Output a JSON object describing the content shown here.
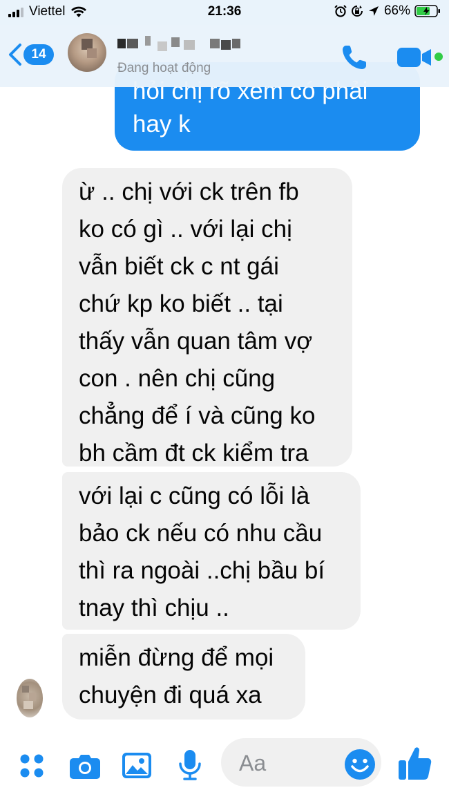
{
  "status_bar": {
    "carrier": "Viettel",
    "time": "21:36",
    "battery": "66%"
  },
  "header": {
    "unread_count": "14",
    "contact_status": "Đang hoạt động"
  },
  "messages": {
    "outgoing_partial": [
      "hỏi chị rõ xem có phải",
      "hay k"
    ],
    "incoming": [
      [
        "ừ .. chị với ck trên fb",
        "ko có gì  .. với lại chị",
        "vẫn biết ck c nt gái",
        "chứ kp ko biết .. tại",
        "thấy vẫn quan tâm vợ",
        "con . nên chị cũng",
        "chẳng để í và cũng ko",
        "bh cầm đt ck kiểm tra"
      ],
      [
        "với lại c cũng có lỗi là",
        "bảo ck nếu có nhu cầu",
        "thì ra ngoài ..chị bầu bí",
        "tnay thì chịu .."
      ],
      [
        "miễn đừng để mọi",
        "chuyện đi quá xa"
      ]
    ]
  },
  "composer": {
    "placeholder": "Aa"
  },
  "colors": {
    "messenger_blue": "#1b8cf0",
    "incoming_bubble": "#f0f0f0",
    "header_bg": "#e9f3fb",
    "online_green": "#31cc46"
  },
  "icons": [
    "signal-icon",
    "wifi-icon",
    "alarm-icon",
    "rotation-lock-icon",
    "location-icon",
    "battery-icon",
    "back-chevron-icon",
    "phone-icon",
    "video-icon",
    "apps-icon",
    "camera-icon",
    "photo-icon",
    "mic-icon",
    "emoji-icon",
    "like-icon"
  ]
}
